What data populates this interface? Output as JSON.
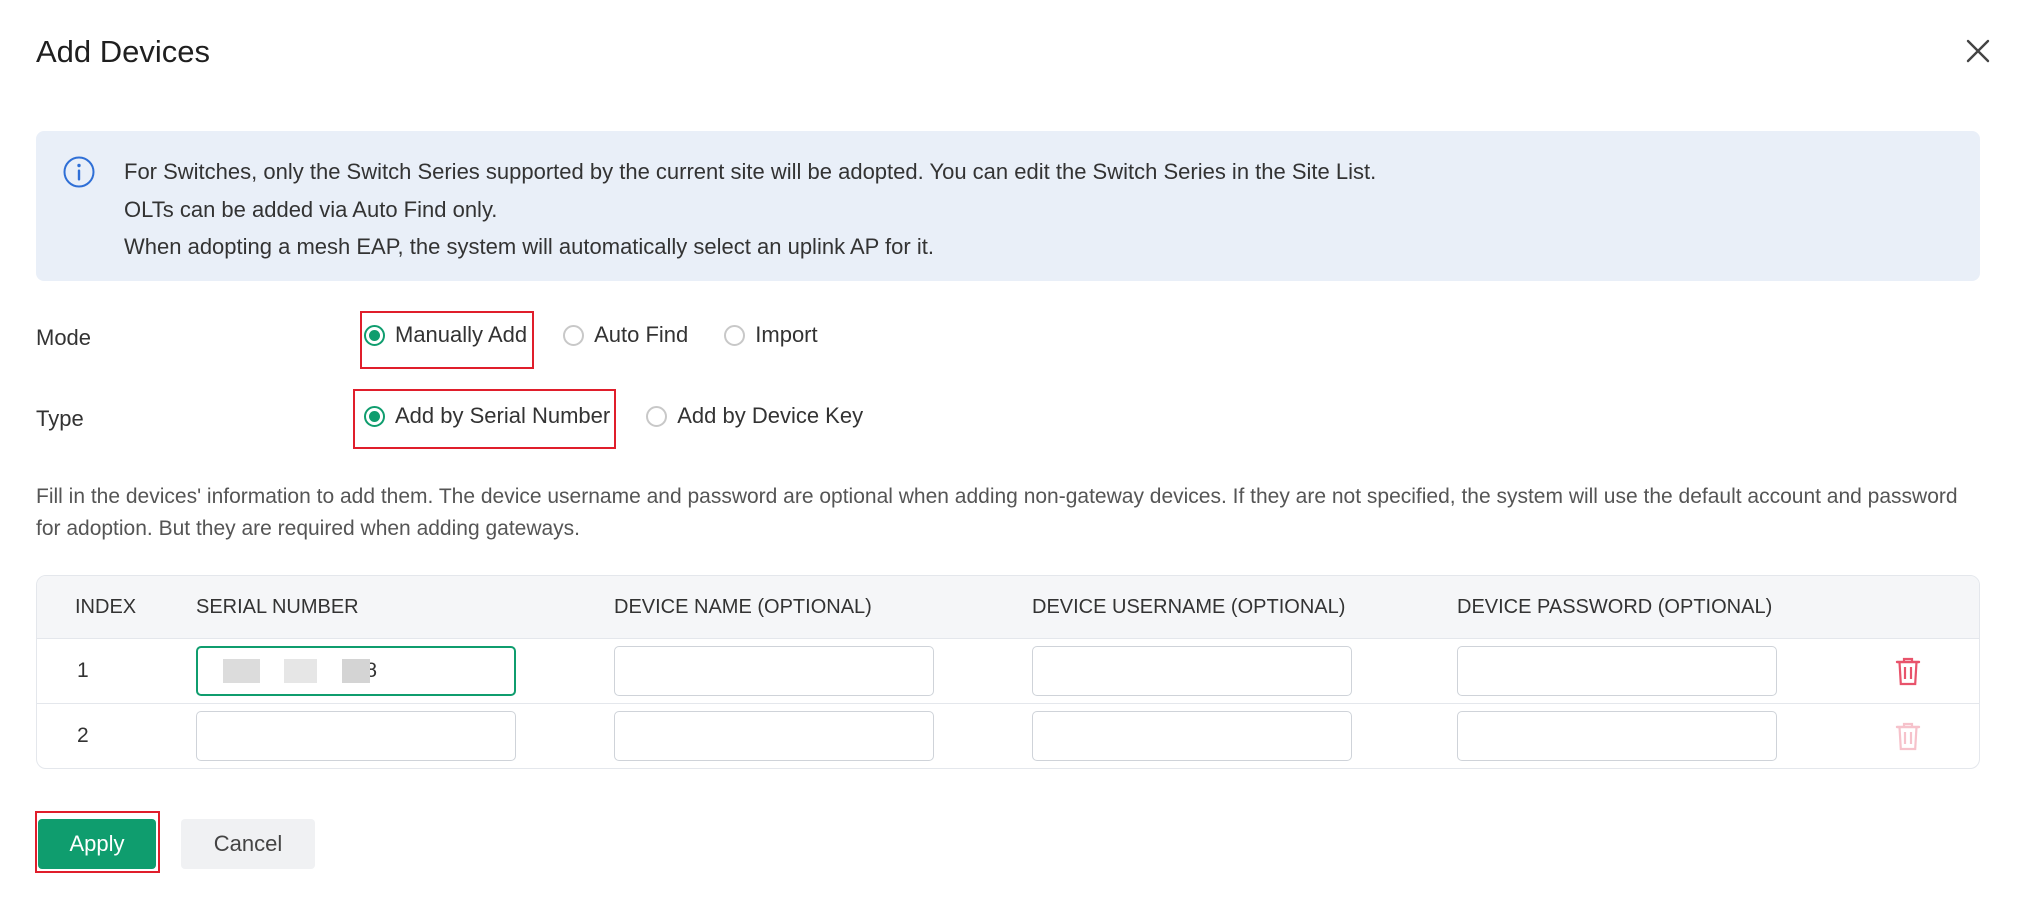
{
  "dialog": {
    "title": "Add Devices",
    "close_icon": "close-icon"
  },
  "info": {
    "icon": "info-icon",
    "lines": [
      "For Switches, only the Switch Series supported by the current site will be adopted. You can edit the Switch Series in the Site List.",
      "OLTs can be added via Auto Find only.",
      "When adopting a mesh EAP, the system will automatically select an uplink AP for it."
    ]
  },
  "mode": {
    "label": "Mode",
    "options": [
      "Manually Add",
      "Auto Find",
      "Import"
    ],
    "selected": "Manually Add"
  },
  "type": {
    "label": "Type",
    "options": [
      "Add by Serial Number",
      "Add by Device Key"
    ],
    "selected": "Add by Serial Number"
  },
  "description": "Fill in the devices' information to add them. The device username and password are optional when adding non-gateway devices. If they are not specified, the system will use the default account and password for adoption. But they are required when adding gateways.",
  "table": {
    "headers": [
      "INDEX",
      "SERIAL NUMBER",
      "DEVICE NAME (OPTIONAL)",
      "DEVICE USERNAME (OPTIONAL)",
      "DEVICE PASSWORD (OPTIONAL)"
    ],
    "rows": [
      {
        "index": "1",
        "serial": "148",
        "name": "",
        "username": "",
        "password": ""
      },
      {
        "index": "2",
        "serial": "",
        "name": "",
        "username": "",
        "password": ""
      }
    ]
  },
  "actions": {
    "apply": "Apply",
    "cancel": "Cancel"
  },
  "colors": {
    "accent": "#0f9d6e",
    "highlight": "#e01e2b",
    "info_bg": "#e9eff8",
    "delete": "#e8536b"
  }
}
